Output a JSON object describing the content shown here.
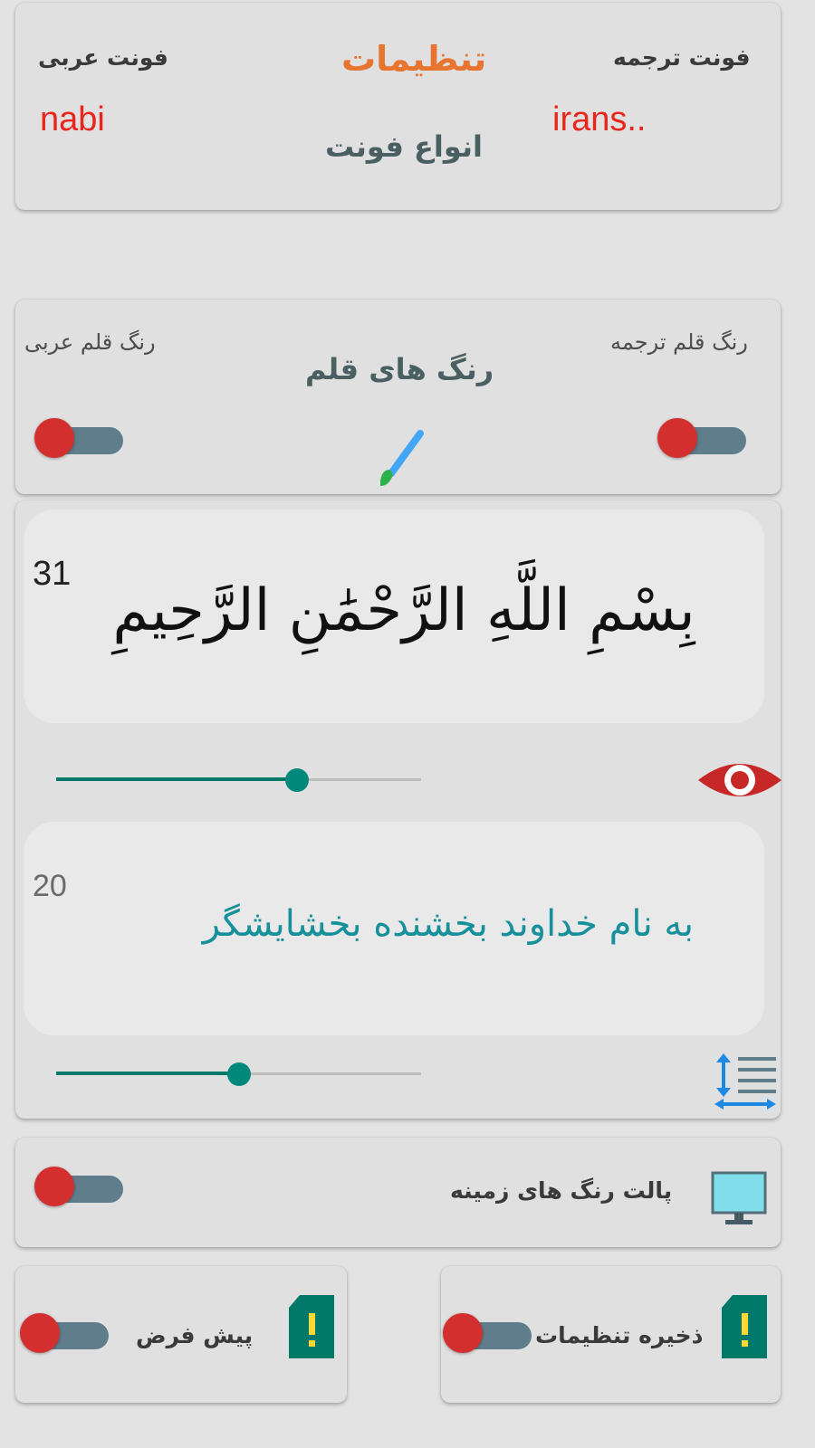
{
  "fonts_card": {
    "title": "تنظیمات",
    "translation_font_label": "فونت ترجمه",
    "arabic_font_label": "فونت عربی",
    "translation_font_value": "irans..",
    "arabic_font_value": "nabi",
    "font_types_label": "انواع فونت"
  },
  "pen_colors_card": {
    "heading": "رنگ های قلم",
    "translation_pen_label": "رنگ قلم ترجمه",
    "arabic_pen_label": "رنگ قلم عربی",
    "translation_switch_on": false,
    "arabic_switch_on": false,
    "brush_icon": "paintbrush-icon"
  },
  "preview": {
    "arabic_size": "31",
    "arabic_text": "بِسْمِ اللَّهِ الرَّحْمَٰنِ الرَّحِيمِ",
    "arabic_slider_fraction": 0.66,
    "eye_icon": "eye-icon",
    "translation_size": "20",
    "translation_text": "به نام خداوند بخشنده بخشایشگر",
    "translation_slider_fraction": 0.5,
    "line_spacing_icon": "line-spacing-icon",
    "colors": {
      "translation_text": "#16909a",
      "arabic_text": "#111111"
    }
  },
  "background_card": {
    "label": "پالت رنگ های زمینه",
    "monitor_icon": "monitor-icon",
    "switch_on": false
  },
  "bottom": {
    "save_label": "ذخیره تنظیمات",
    "default_label": "پیش فرض",
    "warning_icon": "sd-card-warning-icon",
    "save_switch_on": false,
    "default_switch_on": false
  },
  "theme": {
    "accent_orange": "#e8752f",
    "value_red": "#e9261c",
    "switch_thumb": "#d32f2f",
    "switch_track": "#607d8b",
    "slider_teal": "#00796b"
  }
}
